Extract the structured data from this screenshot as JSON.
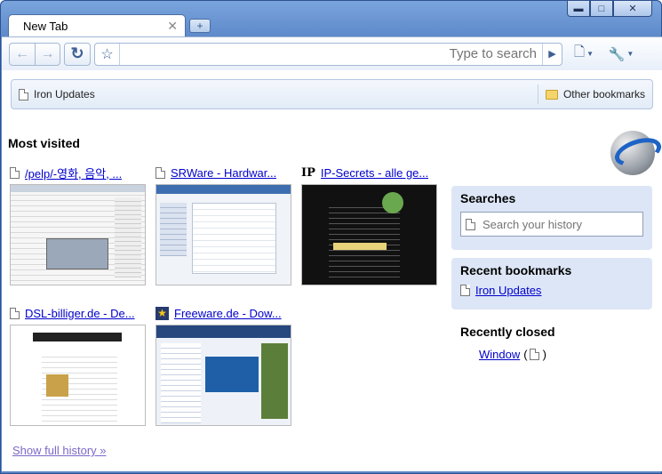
{
  "window": {
    "tab_title": "New Tab",
    "minimize": "▬",
    "maximize": "□",
    "close": "✕"
  },
  "toolbar": {
    "omnibox_placeholder": "Type to search"
  },
  "bookmarks_bar": {
    "items": [
      {
        "label": "Iron Updates"
      }
    ],
    "other_bookmarks": "Other bookmarks"
  },
  "most_visited": {
    "title": "Most visited",
    "thumbnails": [
      {
        "label": "/pelp/-영화, 음악, ..."
      },
      {
        "label": "SRWare - Hardwar..."
      },
      {
        "label": "IP-Secrets - alle ge..."
      },
      {
        "label": "DSL-billiger.de - De..."
      },
      {
        "label": "Freeware.de - Dow..."
      }
    ],
    "show_full_history": "Show full history »"
  },
  "sidebar": {
    "searches": {
      "title": "Searches",
      "placeholder": "Search your history"
    },
    "recent_bookmarks": {
      "title": "Recent bookmarks",
      "items": [
        {
          "label": "Iron Updates"
        }
      ]
    },
    "recently_closed": {
      "title": "Recently closed",
      "items": [
        {
          "label": "Window",
          "open_paren": "(",
          "close_paren": ")"
        }
      ]
    }
  }
}
